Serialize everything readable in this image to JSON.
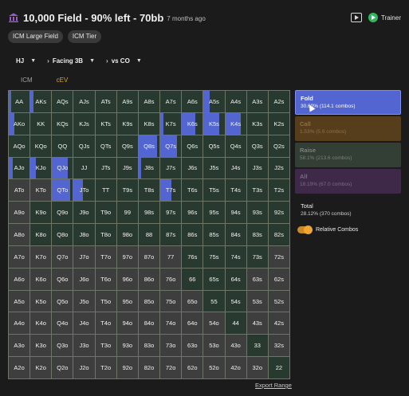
{
  "header": {
    "title": "10,000 Field - 90% left - 70bb",
    "ago": "7 months ago",
    "trainer_label": "Trainer"
  },
  "chips": [
    "ICM Large Field",
    "ICM Tier"
  ],
  "selectors": {
    "position": "HJ",
    "facing": "Facing 3B",
    "versus": "vs CO"
  },
  "mode_tabs": {
    "icm": "ICM",
    "cev": "cEV",
    "active": "cEV"
  },
  "colors": {
    "fold": "#5365d0",
    "call": "#6a4a1e",
    "raise": "#3b4a3e",
    "allin": "#4a2f58",
    "cell_bg": "#283a2f",
    "accent": "#e0a020"
  },
  "hands": [
    [
      "AA",
      "AKs",
      "AQs",
      "AJs",
      "ATs",
      "A9s",
      "A8s",
      "A7s",
      "A6s",
      "A5s",
      "A4s",
      "A3s",
      "A2s"
    ],
    [
      "AKo",
      "KK",
      "KQs",
      "KJs",
      "KTs",
      "K9s",
      "K8s",
      "K7s",
      "K6s",
      "K5s",
      "K4s",
      "K3s",
      "K2s"
    ],
    [
      "AQo",
      "KQo",
      "QQ",
      "QJs",
      "QTs",
      "Q9s",
      "Q8s",
      "Q7s",
      "Q6s",
      "Q5s",
      "Q4s",
      "Q3s",
      "Q2s"
    ],
    [
      "AJo",
      "KJo",
      "QJo",
      "JJ",
      "JTs",
      "J9s",
      "J8s",
      "J7s",
      "J6s",
      "J5s",
      "J4s",
      "J3s",
      "J2s"
    ],
    [
      "ATo",
      "KTo",
      "QTo",
      "JTo",
      "TT",
      "T9s",
      "T8s",
      "T7s",
      "T6s",
      "T5s",
      "T4s",
      "T3s",
      "T2s"
    ],
    [
      "A9o",
      "K9o",
      "Q9o",
      "J9o",
      "T9o",
      "99",
      "98s",
      "97s",
      "96s",
      "95s",
      "94s",
      "93s",
      "92s"
    ],
    [
      "A8o",
      "K8o",
      "Q8o",
      "J8o",
      "T8o",
      "98o",
      "88",
      "87s",
      "86s",
      "85s",
      "84s",
      "83s",
      "82s"
    ],
    [
      "A7o",
      "K7o",
      "Q7o",
      "J7o",
      "T7o",
      "97o",
      "87o",
      "77",
      "76s",
      "75s",
      "74s",
      "73s",
      "72s"
    ],
    [
      "A6o",
      "K6o",
      "Q6o",
      "J6o",
      "T6o",
      "96o",
      "86o",
      "76o",
      "66",
      "65s",
      "64s",
      "63s",
      "62s"
    ],
    [
      "A5o",
      "K5o",
      "Q5o",
      "J5o",
      "T5o",
      "95o",
      "85o",
      "75o",
      "65o",
      "55",
      "54s",
      "53s",
      "52s"
    ],
    [
      "A4o",
      "K4o",
      "Q4o",
      "J4o",
      "T4o",
      "94o",
      "84o",
      "74o",
      "64o",
      "54o",
      "44",
      "43s",
      "42s"
    ],
    [
      "A3o",
      "K3o",
      "Q3o",
      "J3o",
      "T3o",
      "93o",
      "83o",
      "73o",
      "63o",
      "53o",
      "43o",
      "33",
      "32s"
    ],
    [
      "A2o",
      "K2o",
      "Q2o",
      "J2o",
      "T2o",
      "92o",
      "82o",
      "72o",
      "62o",
      "52o",
      "42o",
      "32o",
      "22"
    ]
  ],
  "fold_fraction": [
    [
      0.1,
      0.15,
      0,
      0,
      0,
      0,
      0,
      0,
      0,
      0.3,
      0,
      0,
      0
    ],
    [
      0.25,
      0,
      0,
      0,
      0,
      0,
      0,
      0.15,
      0.65,
      0.75,
      0.75,
      0,
      0
    ],
    [
      0,
      0,
      0,
      0,
      0,
      0,
      0.9,
      0.8,
      0,
      0,
      0,
      0,
      0
    ],
    [
      0.2,
      0.25,
      0.75,
      0,
      0,
      0,
      0.1,
      0,
      0,
      0,
      0,
      0,
      0
    ],
    [
      1,
      1,
      0.85,
      0.45,
      0,
      0,
      0,
      0.55,
      0,
      0,
      0,
      0,
      0
    ],
    [
      1,
      0,
      0,
      0,
      0,
      0,
      0,
      0,
      0,
      0,
      0,
      0,
      0
    ],
    [
      1,
      0,
      0,
      0,
      0,
      0,
      0,
      0,
      0,
      0,
      0,
      0,
      0
    ],
    [
      1,
      1,
      1,
      1,
      1,
      1,
      1,
      1,
      0,
      0,
      0,
      0,
      1
    ],
    [
      1,
      1,
      1,
      1,
      1,
      1,
      1,
      1,
      0,
      0,
      0,
      1,
      1
    ],
    [
      1,
      1,
      1,
      1,
      1,
      1,
      1,
      1,
      1,
      0,
      0,
      1,
      1
    ],
    [
      1,
      1,
      1,
      1,
      1,
      1,
      1,
      1,
      1,
      1,
      0,
      1,
      1
    ],
    [
      1,
      1,
      1,
      1,
      1,
      1,
      1,
      1,
      1,
      1,
      1,
      0,
      1
    ],
    [
      1,
      1,
      1,
      1,
      1,
      1,
      1,
      1,
      1,
      1,
      1,
      1,
      0
    ]
  ],
  "actions": {
    "fold": {
      "name": "Fold",
      "sub": "30.60% (114.1 combos)"
    },
    "call": {
      "name": "Call",
      "sub": "1.53% (5.6 combos)"
    },
    "raise": {
      "name": "Raise",
      "sub": "58.1% (213.6 combos)"
    },
    "allin": {
      "name": "All",
      "sub": "18.19% (67.0 combos)"
    }
  },
  "total": {
    "label": "Total",
    "sub": "28.12% (370 combos)"
  },
  "relative_combos": "Relative Combos",
  "export": "Export Range"
}
